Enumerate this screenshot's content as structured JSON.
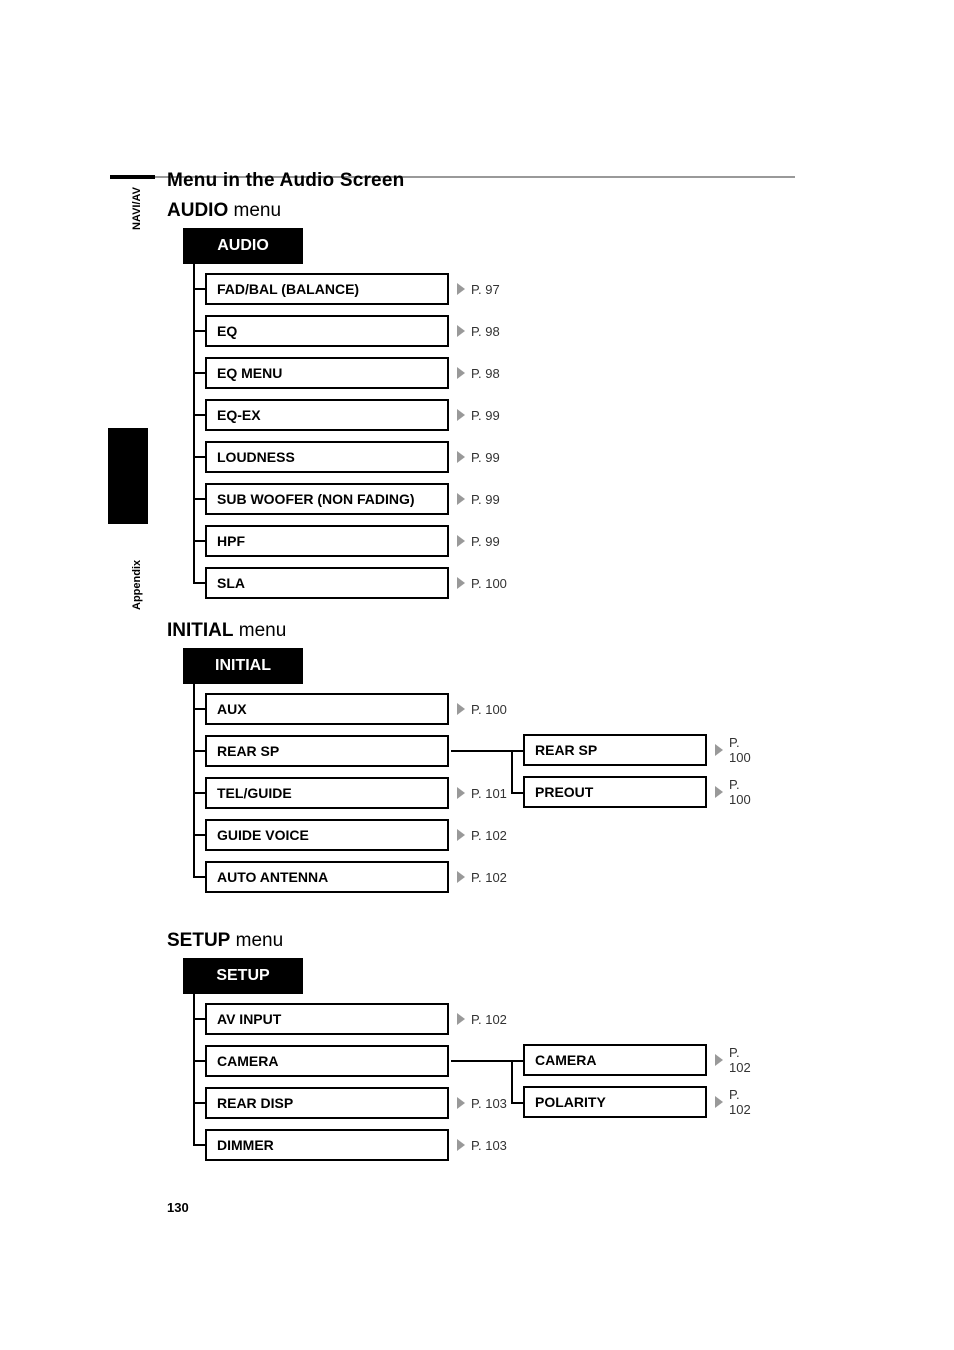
{
  "tabs": {
    "naviav": "NAVI/AV",
    "appendix": "Appendix"
  },
  "header": {
    "section": "Menu in the Audio Screen"
  },
  "audio": {
    "heading_prefix": "AUDIO",
    "heading_suffix": " menu",
    "root": "AUDIO",
    "items": [
      {
        "label": "FAD/BAL (BALANCE)",
        "page": "P. 97"
      },
      {
        "label": "EQ",
        "page": "P. 98"
      },
      {
        "label": "EQ MENU",
        "page": "P. 98"
      },
      {
        "label": "EQ-EX",
        "page": "P. 99"
      },
      {
        "label": "LOUDNESS",
        "page": "P. 99"
      },
      {
        "label": "SUB WOOFER (NON FADING)",
        "page": "P. 99"
      },
      {
        "label": "HPF",
        "page": "P. 99"
      },
      {
        "label": "SLA",
        "page": "P. 100"
      }
    ]
  },
  "initial": {
    "heading_prefix": "INITIAL",
    "heading_suffix": " menu",
    "root": "INITIAL",
    "items": [
      {
        "label": "AUX",
        "page": "P. 100"
      },
      {
        "label": "REAR SP",
        "page": ""
      },
      {
        "label": "TEL/GUIDE",
        "page": "P. 101"
      },
      {
        "label": "GUIDE VOICE",
        "page": "P. 102"
      },
      {
        "label": "AUTO ANTENNA",
        "page": "P. 102"
      }
    ],
    "sub": [
      {
        "label": "REAR SP",
        "page": "P. 100"
      },
      {
        "label": "PREOUT",
        "page": "P. 100"
      }
    ]
  },
  "setup": {
    "heading_prefix": "SETUP",
    "heading_suffix": " menu",
    "root": "SETUP",
    "items": [
      {
        "label": "AV INPUT",
        "page": "P. 102"
      },
      {
        "label": "CAMERA",
        "page": ""
      },
      {
        "label": "REAR DISP",
        "page": "P. 103"
      },
      {
        "label": "DIMMER",
        "page": "P. 103"
      }
    ],
    "sub": [
      {
        "label": "CAMERA",
        "page": "P. 102"
      },
      {
        "label": "POLARITY",
        "page": "P. 102"
      }
    ]
  },
  "pagenum": "130"
}
